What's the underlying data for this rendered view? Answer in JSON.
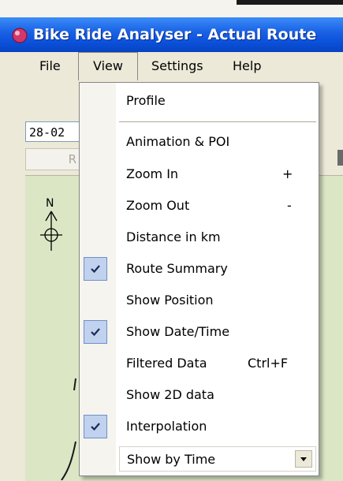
{
  "window": {
    "title": "Bike Ride Analyser - Actual Route"
  },
  "menubar": {
    "file": "File",
    "view": "View",
    "settings": "Settings",
    "help": "Help"
  },
  "controls": {
    "date_value": "28-02",
    "button_label": "R"
  },
  "compass": {
    "north_label": "N"
  },
  "view_menu": {
    "items": [
      {
        "label": "Profile",
        "checked": false,
        "shortcut": ""
      },
      {
        "label": "Animation & POI",
        "checked": false,
        "shortcut": ""
      },
      {
        "label": "Zoom In",
        "checked": false,
        "shortcut": "+"
      },
      {
        "label": "Zoom Out",
        "checked": false,
        "shortcut": "-"
      },
      {
        "label": "Distance in km",
        "checked": false,
        "shortcut": ""
      },
      {
        "label": "Route Summary",
        "checked": true,
        "shortcut": ""
      },
      {
        "label": "Show Position",
        "checked": false,
        "shortcut": ""
      },
      {
        "label": "Show Date/Time",
        "checked": true,
        "shortcut": ""
      },
      {
        "label": "Filtered Data",
        "checked": false,
        "shortcut": "Ctrl+F"
      },
      {
        "label": "Show 2D data",
        "checked": false,
        "shortcut": ""
      },
      {
        "label": "Interpolation",
        "checked": true,
        "shortcut": ""
      }
    ],
    "combo_value": "Show by Time"
  },
  "colors": {
    "titlebar": "#0a4fd8",
    "check_highlight": "#c1d2ee",
    "menu_bg": "#ece9d8"
  }
}
